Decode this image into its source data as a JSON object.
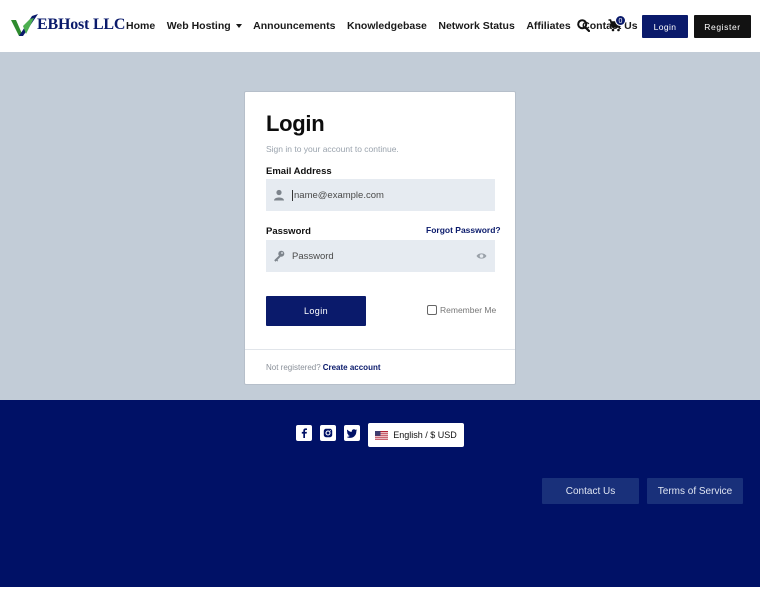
{
  "brand": {
    "name": "EBHost LLC",
    "colors": {
      "primary": "#0a1a6b",
      "footer": "#001166",
      "accent": "#2e8b2e"
    }
  },
  "nav": {
    "items": [
      {
        "label": "Home"
      },
      {
        "label": "Web Hosting",
        "has_dropdown": true
      },
      {
        "label": "Announcements"
      },
      {
        "label": "Knowledgebase"
      },
      {
        "label": "Network Status"
      },
      {
        "label": "Affiliates"
      },
      {
        "label": "Contact Us"
      }
    ],
    "search_icon": "search-icon",
    "cart_icon": "cart-icon",
    "cart_count": "0",
    "login_label": "Login",
    "register_label": "Register"
  },
  "login": {
    "title": "Login",
    "subtitle": "Sign in to your account to continue.",
    "email_label": "Email Address",
    "email_placeholder": "name@example.com",
    "password_label": "Password",
    "password_placeholder": "Password",
    "forgot_label": "Forgot Password?",
    "submit_label": "Login",
    "remember_label": "Remember Me",
    "not_registered": "Not registered?",
    "create_account": "Create account"
  },
  "footer": {
    "social": [
      {
        "icon": "facebook-icon"
      },
      {
        "icon": "instagram-icon"
      },
      {
        "icon": "twitter-icon"
      }
    ],
    "language_label": "English / $ USD",
    "contact_label": "Contact Us",
    "terms_label": "Terms of Service"
  }
}
